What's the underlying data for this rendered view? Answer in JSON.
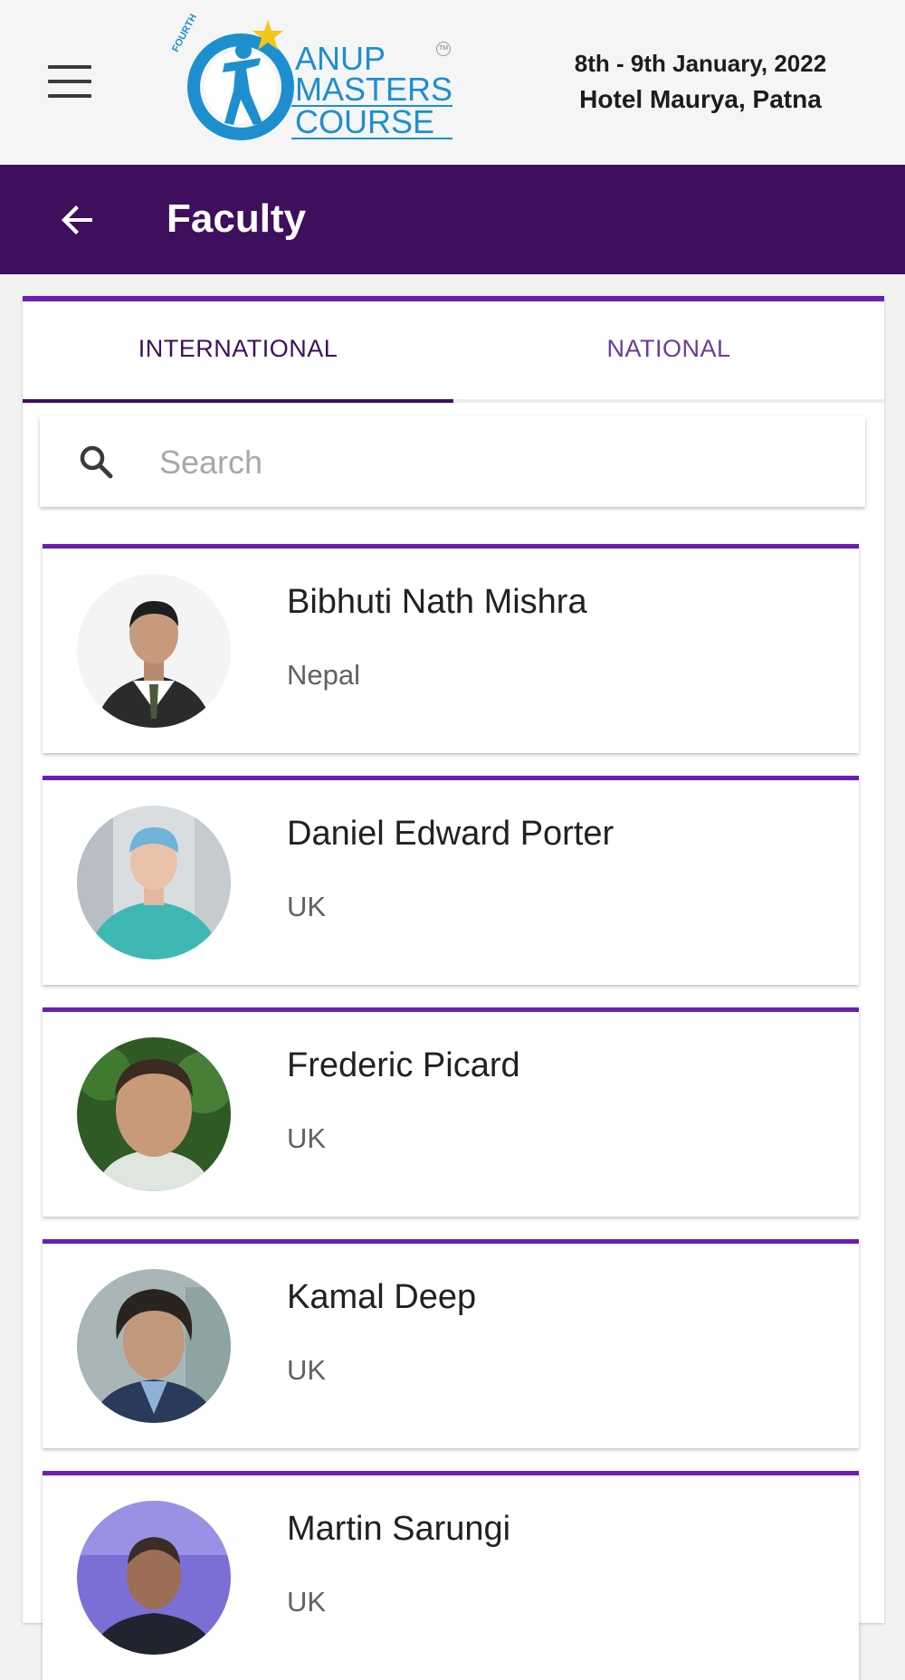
{
  "header": {
    "logo": {
      "small_text": "FOURTH",
      "line1": "ANUP",
      "line2": "MASTERS",
      "line3": "COURSE",
      "tm": "TM"
    },
    "event_date": "8th - 9th January, 2022",
    "event_venue": "Hotel Maurya, Patna",
    "menu_icon": "hamburger-menu-icon"
  },
  "appbar": {
    "title": "Faculty",
    "back_icon": "arrow-left-icon"
  },
  "tabs": [
    {
      "label": "INTERNATIONAL",
      "active": true
    },
    {
      "label": "NATIONAL",
      "active": false
    }
  ],
  "search": {
    "placeholder": "Search",
    "value": "",
    "icon": "search-icon"
  },
  "faculty": [
    {
      "name": "Bibhuti Nath Mishra",
      "country": "Nepal"
    },
    {
      "name": "Daniel Edward Porter",
      "country": "UK"
    },
    {
      "name": "Frederic Picard",
      "country": "UK"
    },
    {
      "name": "Kamal Deep",
      "country": "UK"
    },
    {
      "name": "Martin Sarungi",
      "country": "UK"
    }
  ],
  "colors": {
    "primary": "#3e0f5c",
    "accent": "#6a1fb0",
    "logo_blue": "#1d8fcf",
    "logo_star": "#f5c518"
  }
}
